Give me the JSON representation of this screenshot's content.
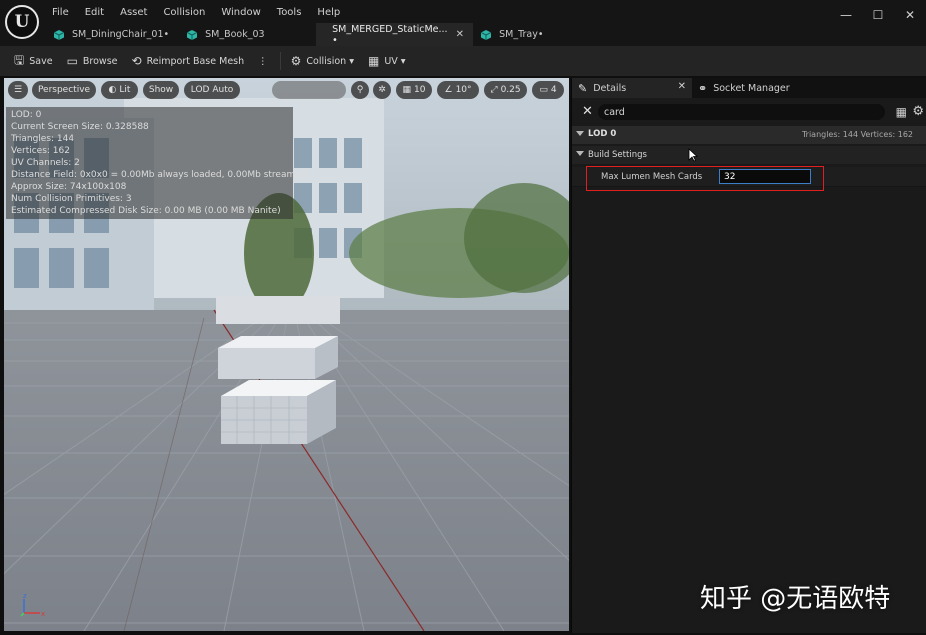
{
  "app": {
    "logo": "ue-logo"
  },
  "menu": [
    "File",
    "Edit",
    "Asset",
    "Collision",
    "Window",
    "Tools",
    "Help"
  ],
  "window_controls": {
    "minimize": "—",
    "maximize": "☐",
    "close": "✕"
  },
  "tabs": [
    {
      "label": "SM_DiningChair_01•",
      "active": false
    },
    {
      "label": "SM_Book_03",
      "active": false
    },
    {
      "label": "SM_MERGED_StaticMe... •",
      "active": true,
      "close": "✕"
    },
    {
      "label": "SM_Tray•",
      "active": false
    }
  ],
  "toolbar": {
    "save": "Save",
    "browse": "Browse",
    "reimport": "Reimport Base Mesh",
    "more": "⋮",
    "collision": "Collision",
    "uv": "UV"
  },
  "viewport": {
    "perspective": "Perspective",
    "lit": "Lit",
    "show": "Show",
    "lod": "LOD Auto",
    "grid_value": "10",
    "angle_value": "10°",
    "scale_value": "0.25",
    "camera_speed": "4",
    "stats": [
      "LOD:  0",
      "Current Screen Size:  0.328588",
      "Triangles:  144",
      "Vertices:  162",
      "UV Channels:  2",
      "Distance Field:  0x0x0 = 0.00Mb always loaded, 0.00Mb streamed",
      "Approx Size: 74x100x108",
      "Num Collision Primitives:  3",
      "Estimated Compressed Disk Size: 0.00 MB (0.00 MB Nanite)"
    ],
    "axis": {
      "x": "x",
      "z": "z"
    }
  },
  "details": {
    "tab_details": "Details",
    "tab_socket": "Socket Manager",
    "close": "✕",
    "search_value": "card",
    "lod_title": "LOD 0",
    "lod_stats": "Triangles: 144   Vertices: 162",
    "build_settings": "Build Settings",
    "prop_label": "Max Lumen Mesh Cards",
    "prop_value": "32"
  },
  "watermark": "知乎 @无语欧特",
  "colors": {
    "accent": "#3d7ec9",
    "highlight": "#e02020",
    "asset_icon": "#2fb5a8"
  }
}
